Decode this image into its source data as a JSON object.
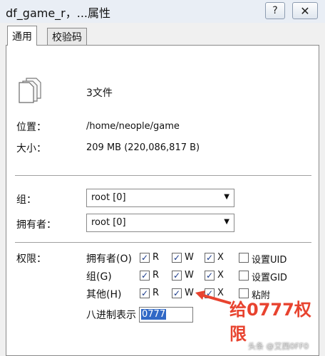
{
  "window": {
    "title": "df_game_r，...属性",
    "help_label": "?",
    "close_label": "✕"
  },
  "tabs": [
    {
      "label": "通用",
      "active": true
    },
    {
      "label": "校验码",
      "active": false
    }
  ],
  "file": {
    "icon": "files-icon",
    "count_text": "3文件"
  },
  "info": {
    "location_label": "位置：",
    "location_value": "/home/neople/game",
    "size_label": "大小：",
    "size_value": "209 MB (220,086,817 B)"
  },
  "ownership": {
    "group_label": "组：",
    "group_value": "root [0]",
    "owner_label": "拥有者：",
    "owner_value": "root [0]"
  },
  "permissions": {
    "label": "权限：",
    "rows": [
      {
        "name": "拥有者(O)",
        "r": true,
        "w": true,
        "x": true,
        "extra_label": "设置UID",
        "extra_checked": false
      },
      {
        "name": "组(G)",
        "r": true,
        "w": true,
        "x": true,
        "extra_label": "设置GID",
        "extra_checked": false
      },
      {
        "name": "其他(H)",
        "r": true,
        "w": true,
        "x": true,
        "extra_label": "粘附",
        "extra_checked": false
      }
    ],
    "r_label": "R",
    "w_label": "W",
    "x_label": "X",
    "octal_label": "八进制表示",
    "octal_value": "0777"
  },
  "annotation": {
    "text": "给0777权限",
    "color": "#e8432f"
  },
  "watermark": "头条 @艾西0FF0"
}
